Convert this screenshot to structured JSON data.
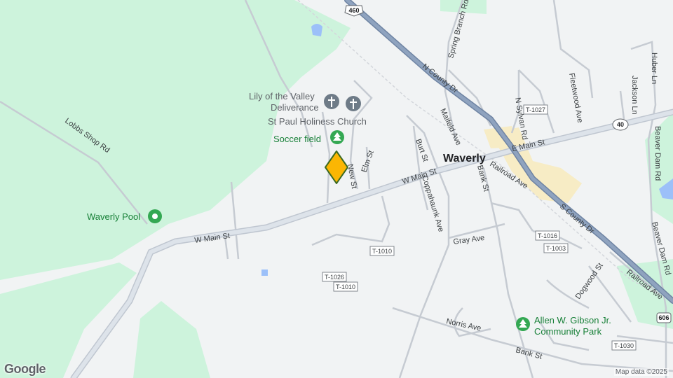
{
  "map": {
    "town": "Waverly",
    "highways": {
      "us460": "460",
      "sr40": "40",
      "sr606": "606"
    },
    "roads": {
      "n_county_dr": "N County Dr",
      "s_county_dr": "S County Dr",
      "w_main_st_1": "W Main St",
      "w_main_st_2": "W Main St",
      "e_main_st": "E Main St",
      "lobbs_shop_rd": "Lobbs Shop Rd",
      "spring_branch_rd": "Spring Branch Rd",
      "maifeld_ave": "Maifeld Ave",
      "n_sylvan_rd": "N Sylvan Rd",
      "fleetwood_ave": "Fleetwood Ave",
      "jackson_ln": "Jackson Ln",
      "huber_ln": "Huber Ln",
      "beaver_dam_rd_1": "Beaver Dam Rd",
      "beaver_dam_rd_2": "Beaver Dam Rd",
      "elm_st": "Elm St",
      "new_st": "New St",
      "burt_st": "Burt St",
      "coppahaunk_ave": "Coppahaunk Ave",
      "bank_st_1": "Bank St",
      "bank_st_2": "Bank St",
      "railroad_ave_1": "Railroad Ave",
      "railroad_ave_2": "Railroad Ave",
      "gray_ave": "Gray Ave",
      "dogwood_st": "Dogwood St",
      "norris_ave": "Norris Ave"
    },
    "route_shields": {
      "t1027": "T-1027",
      "t1016": "T-1016",
      "t1003": "T-1003",
      "t1010a": "T-1010",
      "t1026": "T-1026",
      "t1010b": "T-1010",
      "t1030": "T-1030"
    },
    "places": {
      "lily_line1": "Lily of the Valley",
      "lily_line2": "Deliverance",
      "st_paul": "St Paul Holiness Church",
      "soccer_field": "Soccer field",
      "waverly_pool": "Waverly Pool",
      "gibson_line1": "Allen W. Gibson Jr.",
      "gibson_line2": "Community Park"
    },
    "icons": {
      "church": "church-icon",
      "park": "tree-icon",
      "pool": "pool-icon",
      "pin": "location-pin-icon"
    },
    "colors": {
      "land": "#f1f3f4",
      "green": "#cdf3dc",
      "water": "#9cc0f9",
      "highway": "#8a9db8",
      "park_icon": "#34a853",
      "pin": "#fbb603"
    }
  },
  "attribution": "Map data ©2025",
  "logo": "Google"
}
